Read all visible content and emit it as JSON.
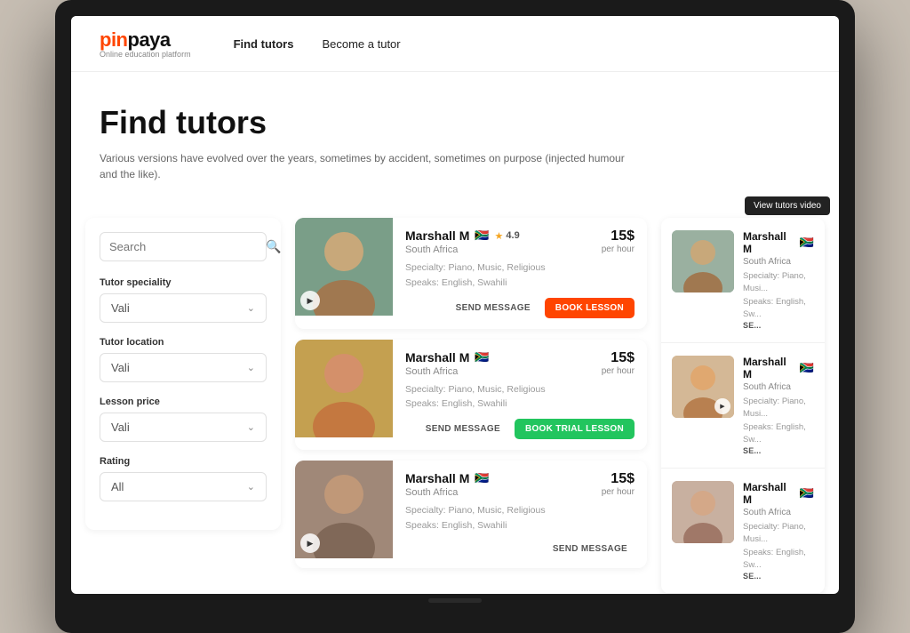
{
  "brand": {
    "name_part1": "pin",
    "name_part2": "paya",
    "tagline": "Online education platform"
  },
  "nav": {
    "links": [
      {
        "id": "find-tutors",
        "label": "Find tutors",
        "active": true
      },
      {
        "id": "become-tutor",
        "label": "Become a tutor",
        "active": false
      }
    ]
  },
  "hero": {
    "title": "Find tutors",
    "description": "Various versions have evolved over the years, sometimes by accident, sometimes on purpose (injected humour and the like)."
  },
  "filters": {
    "search_placeholder": "Search",
    "speciality": {
      "label": "Tutor speciality",
      "value": "Vali"
    },
    "location": {
      "label": "Tutor location",
      "value": "Vali"
    },
    "price": {
      "label": "Lesson price",
      "value": "Vali"
    },
    "rating": {
      "label": "Rating",
      "value": "All"
    }
  },
  "tutors": [
    {
      "name": "Marshall M",
      "location": "South Africa",
      "rating": "4.9",
      "price": "15$",
      "per": "per hour",
      "specialty_label": "Specialty:",
      "specialty": "Piano, Music, Religious",
      "speaks_label": "Speaks:",
      "speaks": "English, Swahili",
      "has_video": true,
      "online": true,
      "btn_primary": "BOOK LESSON",
      "btn_primary_type": "book",
      "btn_secondary": "SEND MESSAGE"
    },
    {
      "name": "Marshall M",
      "location": "South Africa",
      "rating": "",
      "price": "15$",
      "per": "per hour",
      "specialty_label": "Specialty:",
      "specialty": "Piano, Music, Religious",
      "speaks_label": "Speaks:",
      "speaks": "English, Swahili",
      "has_video": false,
      "online": true,
      "btn_primary": "BOOK TRIAL LESSON",
      "btn_primary_type": "trial",
      "btn_secondary": "SEND MESSAGE"
    },
    {
      "name": "Marshall M",
      "location": "South Africa",
      "rating": "",
      "price": "15$",
      "per": "per hour",
      "specialty_label": "Specialty:",
      "specialty": "Piano, Music, Religious",
      "speaks_label": "Speaks:",
      "speaks": "English, Swahili",
      "has_video": true,
      "online": false,
      "btn_primary": "",
      "btn_primary_type": "",
      "btn_secondary": "SEND MESSAGE"
    }
  ],
  "right_overlay": {
    "video_badge": "View tutors video",
    "cards": [
      {
        "name": "Marshall M",
        "location": "South Africa",
        "specialty_label": "Specialty:",
        "specialty": "Piano, Musi...",
        "speaks_label": "Speaks:",
        "speaks": "English, Sw...",
        "has_video": false,
        "btn": "SE..."
      },
      {
        "name": "Marshall M",
        "location": "South Africa",
        "specialty_label": "Specialty:",
        "specialty": "Piano, Musi...",
        "speaks_label": "Speaks:",
        "speaks": "English, Sw...",
        "has_video": true,
        "btn": "SE..."
      },
      {
        "name": "Marshall M",
        "location": "South Africa",
        "specialty_label": "Specialty:",
        "specialty": "Piano, Musi...",
        "speaks_label": "Speaks:",
        "speaks": "English, Sw...",
        "has_video": false,
        "btn": "SE..."
      }
    ]
  }
}
